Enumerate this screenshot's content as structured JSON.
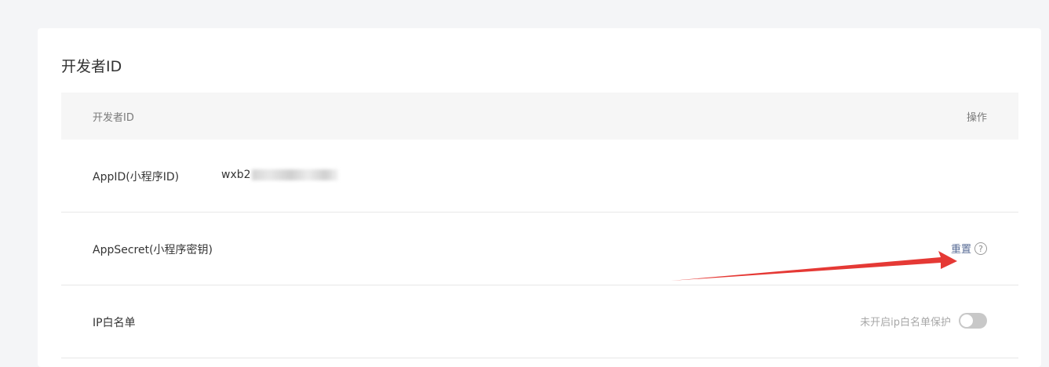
{
  "section": {
    "title": "开发者ID"
  },
  "table": {
    "header_left": "开发者ID",
    "header_right": "操作"
  },
  "rows": {
    "appid": {
      "label": "AppID(小程序ID)",
      "value_prefix": "wxb2"
    },
    "appsecret": {
      "label": "AppSecret(小程序密钥)",
      "action_label": "重置",
      "help_icon": "question-circle-icon"
    },
    "ip_whitelist": {
      "label": "IP白名单",
      "status_text": "未开启ip白名单保护",
      "toggle_on": false
    }
  },
  "annotation": {
    "arrow_color": "#e53935"
  }
}
